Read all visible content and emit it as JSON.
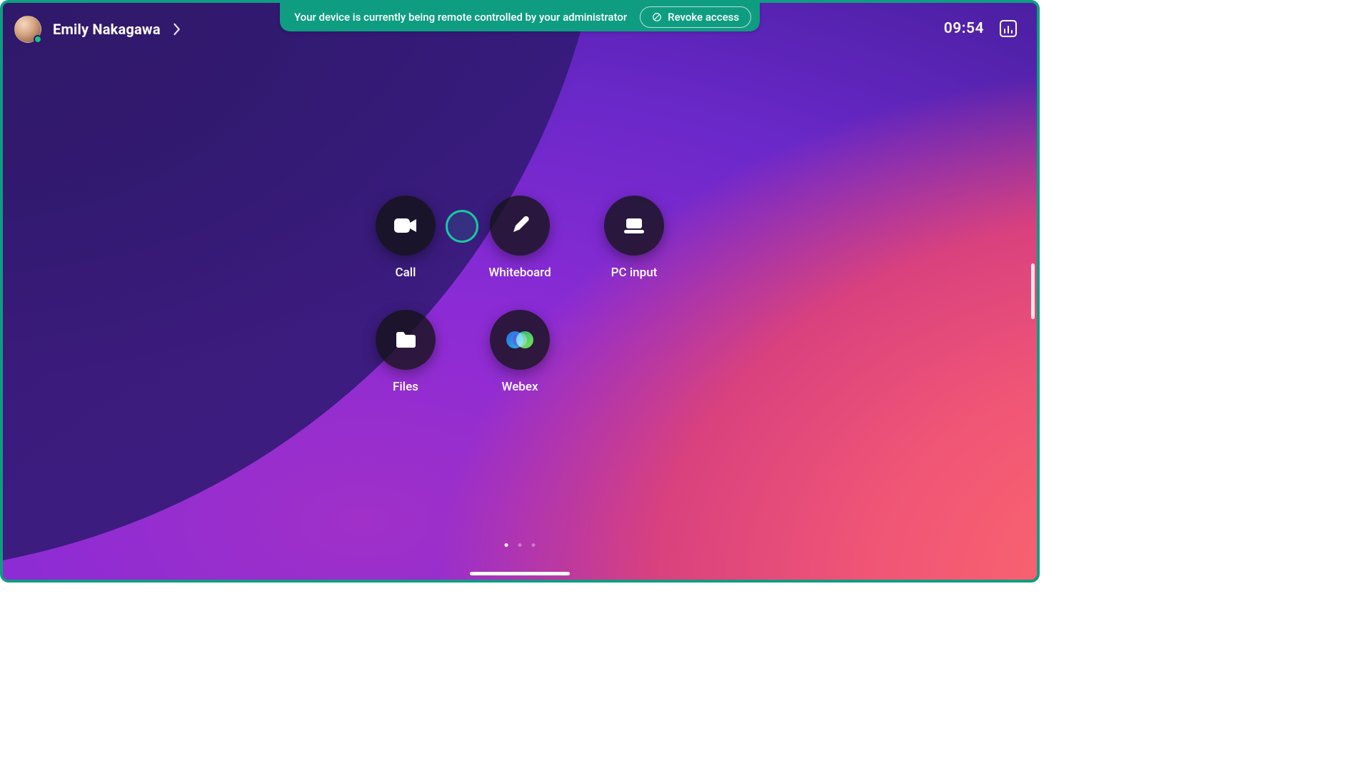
{
  "banner": {
    "message": "Your device is currently being remote controlled by your administrator",
    "revoke_label": "Revoke access"
  },
  "user": {
    "name": "Emily Nakagawa",
    "presence": "active"
  },
  "clock": "09:54",
  "apps": [
    {
      "id": "call",
      "label": "Call"
    },
    {
      "id": "whiteboard",
      "label": "Whiteboard"
    },
    {
      "id": "pc-input",
      "label": "PC input"
    },
    {
      "id": "files",
      "label": "Files"
    },
    {
      "id": "webex",
      "label": "Webex"
    }
  ],
  "pagination": {
    "pages": 3,
    "active": 0
  },
  "colors": {
    "accent_teal": "#0f9d82",
    "ripple": "#19c9a0"
  }
}
